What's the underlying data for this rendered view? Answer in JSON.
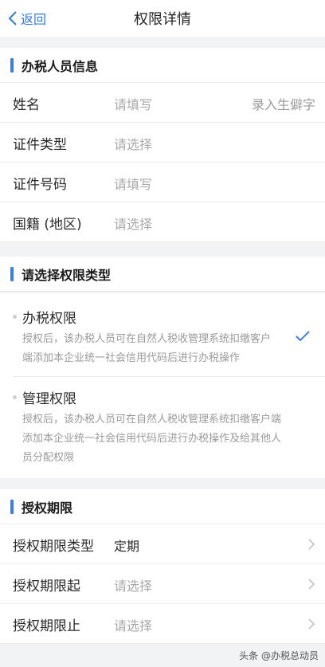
{
  "header": {
    "back_label": "返回",
    "title": "权限详情"
  },
  "section1": {
    "title": "办税人员信息",
    "rows": [
      {
        "label": "姓名",
        "value": "请填写",
        "hint": "录入生僻字"
      },
      {
        "label": "证件类型",
        "value": "请选择"
      },
      {
        "label": "证件号码",
        "value": "请填写"
      },
      {
        "label": "国籍 (地区)",
        "value": "请选择"
      }
    ]
  },
  "section2": {
    "title": "请选择权限类型",
    "options": [
      {
        "title": "办税权限",
        "desc_line1": "授权后，该办税人员可在自然人税收管理系统扣缴客户",
        "desc_line2": "端添加本企业统一社会信用代码后进行办税操作",
        "selected": true
      },
      {
        "title": "管理权限",
        "desc_line1": "授权后，该办税人员可在自然人税收管理系统扣缴客户端",
        "desc_line2": "添加本企业统一社会信用代码后进行办税操作及给其他人",
        "desc_line3": "员分配权限",
        "selected": false
      }
    ]
  },
  "section3": {
    "title": "授权期限",
    "rows": [
      {
        "label": "授权期限类型",
        "value": "定期"
      },
      {
        "label": "授权期限起",
        "value": "请选择"
      },
      {
        "label": "授权期限止",
        "value": "请选择"
      }
    ]
  },
  "watermark": "头条 @办税总动员",
  "colors": {
    "accent": "#3b7de9",
    "back": "#2f7be2",
    "placeholder": "#a8a8a8",
    "background": "#f2f3f5"
  },
  "icons": {
    "back": "chevron-left-icon",
    "selected": "checkmark-icon",
    "row_arrow": "chevron-right-icon"
  }
}
